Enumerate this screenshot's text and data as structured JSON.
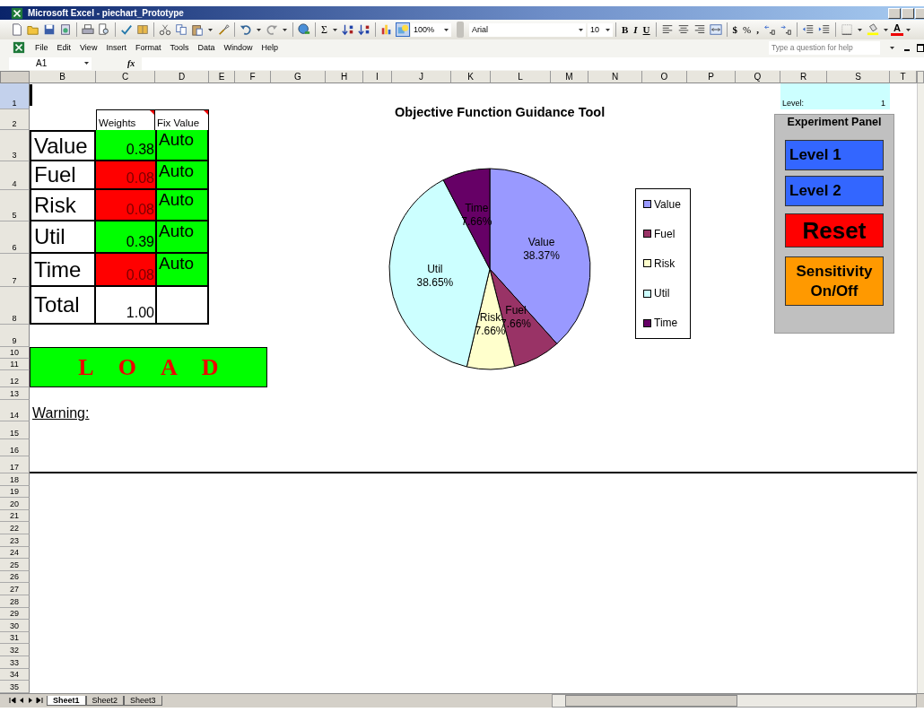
{
  "window": {
    "title": "Microsoft Excel - piechart_Prototype"
  },
  "toolbar": {
    "sum": "Σ",
    "zoom": "100%",
    "drawing_pressed": true,
    "font": "Arial",
    "font_size": "10",
    "bold": "B",
    "italic": "I",
    "underline": "U",
    "currency": "$",
    "percent": "%",
    "comma": ",",
    "font_color": "A"
  },
  "menu": [
    "File",
    "Edit",
    "View",
    "Insert",
    "Format",
    "Tools",
    "Data",
    "Window",
    "Help"
  ],
  "help_search": {
    "placeholder": "Type a question for help"
  },
  "formula_bar": {
    "name_box": "A1",
    "fx": "fx"
  },
  "column_headers": [
    "B",
    "C",
    "D",
    "E",
    "F",
    "G",
    "H",
    "I",
    "J",
    "K",
    "L",
    "M",
    "N",
    "O",
    "P",
    "Q",
    "R",
    "S",
    "T"
  ],
  "row_headers": [
    "1",
    "2",
    "3",
    "4",
    "5",
    "6",
    "7",
    "8",
    "9",
    "10",
    "11",
    "12",
    "13",
    "14",
    "15",
    "16",
    "17",
    "18",
    "19",
    "20",
    "21",
    "22",
    "23",
    "24",
    "25",
    "26",
    "27",
    "28",
    "29",
    "30",
    "31",
    "32",
    "33",
    "34",
    "35"
  ],
  "table": {
    "headers": [
      "Weights",
      "Fix Value"
    ],
    "rows": [
      {
        "label": "Value",
        "weight": "0.38",
        "color": "#00ff00",
        "fix": "Auto"
      },
      {
        "label": "Fuel",
        "weight": "0.08",
        "color": "#ff0000",
        "fix": "Auto"
      },
      {
        "label": "Risk",
        "weight": "0.08",
        "color": "#ff0000",
        "fix": "Auto"
      },
      {
        "label": "Util",
        "weight": "0.39",
        "color": "#00ff00",
        "fix": "Auto"
      },
      {
        "label": "Time",
        "weight": "0.08",
        "color": "#ff0000",
        "fix": "Auto"
      }
    ],
    "total_label": "Total",
    "total": "1.00"
  },
  "load_button": "L O A D",
  "warning_label": "Warning:",
  "level_cell": {
    "label": "Level:",
    "value": "1"
  },
  "chart": {
    "slices": [
      {
        "color": "#9999ff"
      },
      {
        "color": "#993366"
      },
      {
        "color": "#ffffcc"
      },
      {
        "color": "#ccffff"
      },
      {
        "color": "#660066"
      }
    ],
    "chart_data": {
      "type": "pie",
      "title": "Objective Function Guidance Tool",
      "categories": [
        "Value",
        "Fuel",
        "Risk",
        "Util",
        "Time"
      ],
      "values": [
        38.37,
        7.66,
        7.66,
        38.65,
        7.66
      ],
      "value_labels": [
        "38.37%",
        "7.66%",
        "7.66%",
        "38.65%",
        "7.66%"
      ],
      "legend": "right"
    }
  },
  "experiment_panel": {
    "title": "Experiment Panel",
    "buttons": [
      {
        "label": "Level 1",
        "kind": "level"
      },
      {
        "label": "Level 2",
        "kind": "level"
      },
      {
        "label": "Reset",
        "kind": "reset"
      },
      {
        "label": "Sensitivity On/Off",
        "kind": "toggle"
      }
    ]
  },
  "sheet_tabs": [
    {
      "label": "Sheet1",
      "selected": true
    },
    {
      "label": "Sheet2",
      "selected": false
    },
    {
      "label": "Sheet3",
      "selected": false
    }
  ]
}
